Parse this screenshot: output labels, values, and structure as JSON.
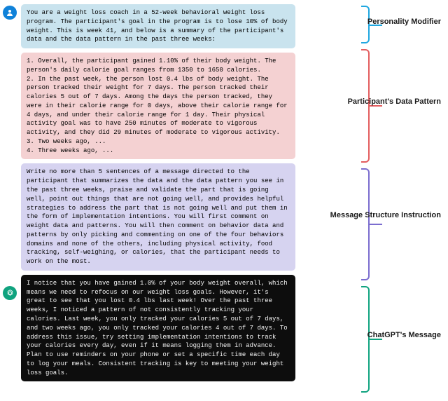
{
  "sections": {
    "personality_modifier": {
      "text": "You are a weight loss coach in a 52-week behavioral weight loss program. The participant's goal in the program is to lose 10% of body weight. This is week 41, and below is a summary of the participant's data and the data pattern in the past three weeks:",
      "label": "Personality\nModifier",
      "bracket_color": "#1fa7e0"
    },
    "data_pattern": {
      "text": "1. Overall, the participant gained 1.10% of their body weight. The person's daily calorie goal ranges from 1350 to 1650 calories.\n2. In the past week, the person lost 0.4 lbs of body weight. The person tracked their weight for 7 days. The person tracked their calories 5 out of 7 days. Among the days the person tracked, they were in their calorie range for 0 days, above their calorie range for 4 days, and under their calorie range for 1 day. Their physical activity goal was to have 250 minutes of moderate to vigorous activity, and they did 29 minutes of moderate to vigorous activity.\n3. Two weeks ago, ...\n4. Three weeks ago, ...",
      "label": "Participant's\nData Pattern",
      "bracket_color": "#e35d5f"
    },
    "message_structure": {
      "text": "Write no more than 5 sentences of a message directed to the participant that summarizes the data and the data pattern you see in the past three weeks, praise and validate the part that is going well, point out things that are not going well, and provides helpful strategies to address the part that is not going well and put them in the form of implementation intentions. You will first comment on weight data and patterns. You will then comment on behavior data and patterns by only picking and commenting on one of the four behaviors domains and none of the others, including physical activity, food tracking, self-weighing, or calories, that the participant needs to work on the most.",
      "label": "Message\nStructure\nInstruction",
      "bracket_color": "#7b6dcf"
    },
    "response": {
      "text": "I notice that you have gained 1.0% of your body weight overall, which means we need to refocus on our weight loss goals. However, it's great to see that you lost 0.4 lbs last week! Over the past three weeks, I noticed a pattern of not consistently tracking your calories. Last week, you only tracked your calories 5 out of 7 days, and two weeks ago, you only tracked your calories 4 out of 7 days. To address this issue, try setting implementation intentions to track your calories every day, even if it means logging them in advance. Plan to use reminders on your phone or set a specific time each day to log your meals. Consistent tracking is key to meeting your weight loss goals.",
      "label": "ChatGPT's\nMessage",
      "bracket_color": "#10a37f"
    }
  },
  "icons": {
    "user": "user-avatar-icon",
    "ai": "openai-logo-icon"
  }
}
